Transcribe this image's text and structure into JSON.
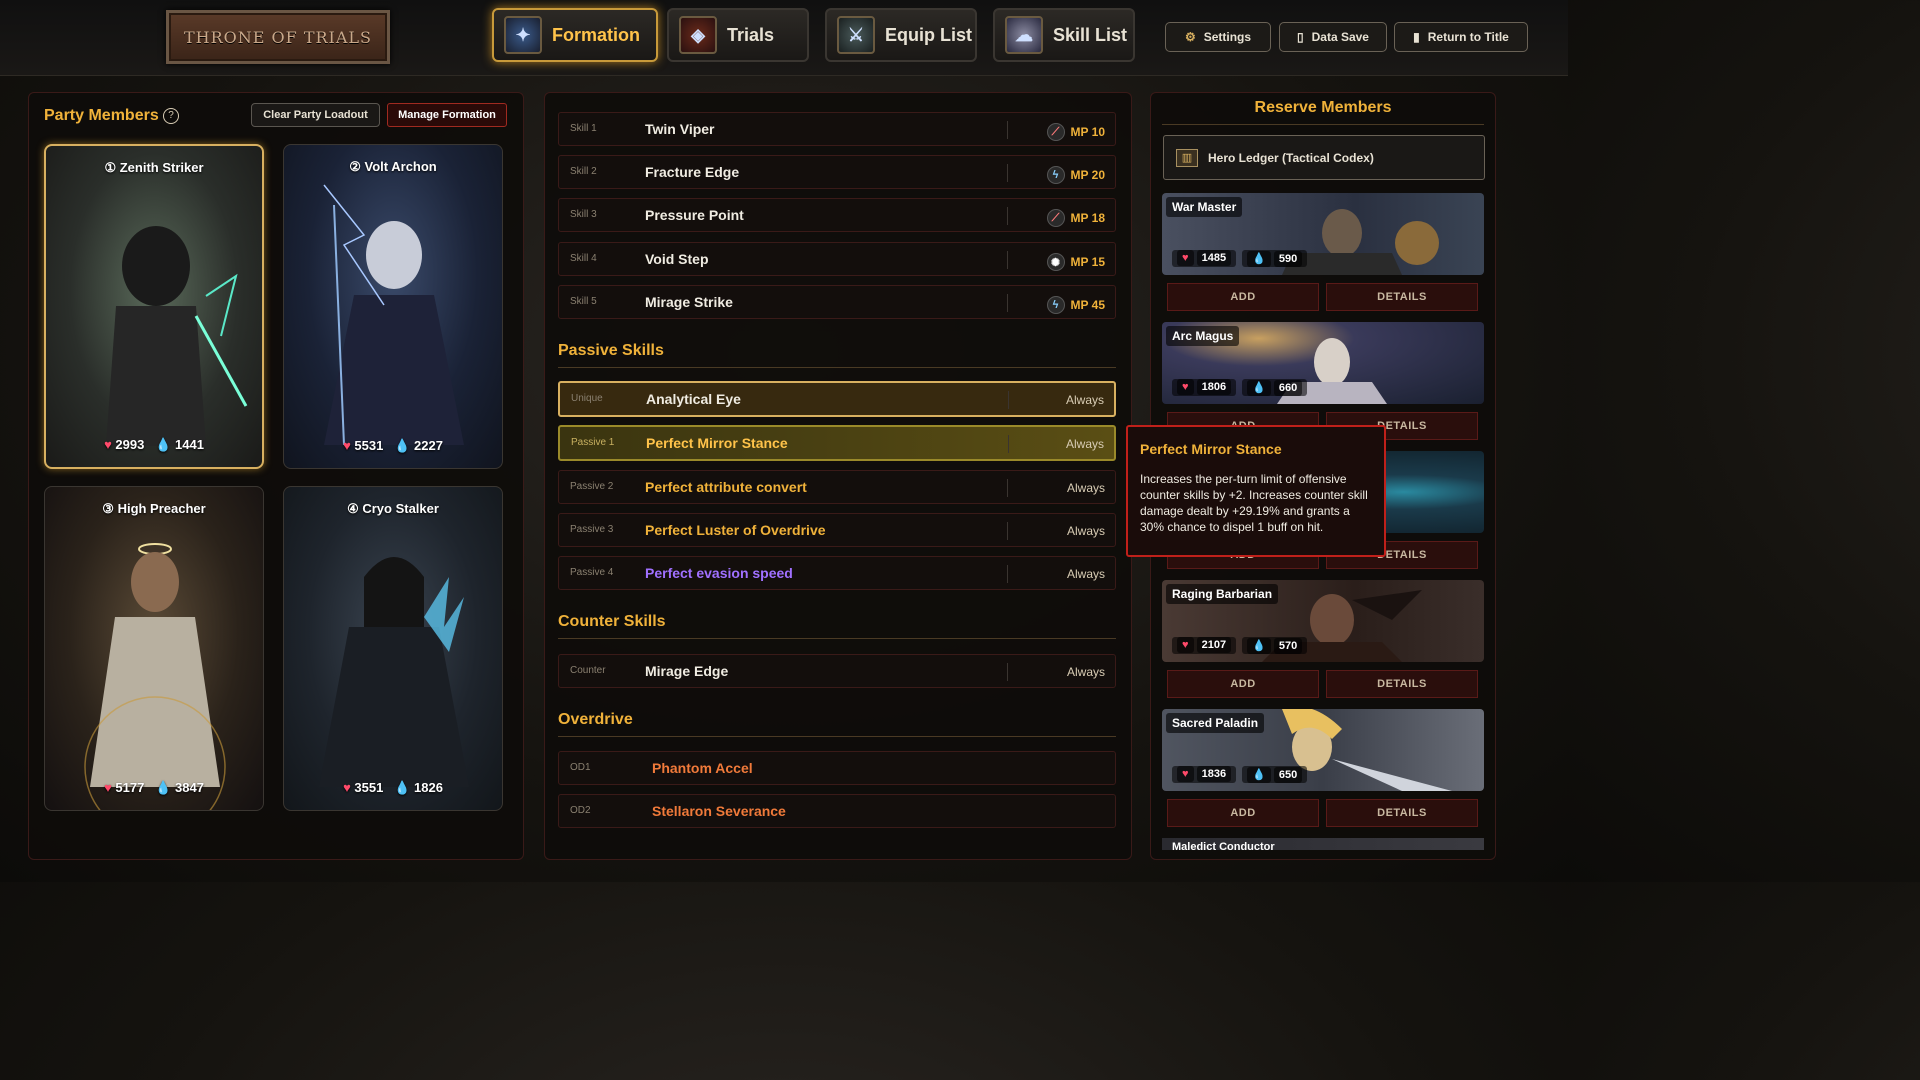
{
  "logo": {
    "text": "THRONE OF TRIALS"
  },
  "tabs": [
    {
      "label": "Formation",
      "icon": "formation-icon",
      "active": true
    },
    {
      "label": "Trials",
      "icon": "trials-icon",
      "active": false
    },
    {
      "label": "Equip List",
      "icon": "equip-icon",
      "active": false
    },
    {
      "label": "Skill List",
      "icon": "skill-icon",
      "active": false
    }
  ],
  "top_buttons": {
    "settings": "Settings",
    "data_save": "Data Save",
    "return": "Return to Title"
  },
  "party": {
    "title": "Party Members",
    "help": "?",
    "clear_button": "Clear Party Loadout",
    "manage_button": "Manage Formation",
    "members": [
      {
        "num": "①",
        "name": "Zenith Striker",
        "hp": "2993",
        "mp": "1441"
      },
      {
        "num": "②",
        "name": "Volt Archon",
        "hp": "5531",
        "mp": "2227"
      },
      {
        "num": "③",
        "name": "High Preacher",
        "hp": "5177",
        "mp": "3847"
      },
      {
        "num": "④",
        "name": "Cryo Stalker",
        "hp": "3551",
        "mp": "1826"
      }
    ]
  },
  "skills": [
    {
      "slot": "Skill 1",
      "name": "Twin Viper",
      "cost": "MP 10",
      "icon": "slash-icon"
    },
    {
      "slot": "Skill 2",
      "name": "Fracture Edge",
      "cost": "MP 20",
      "icon": "lightning-icon"
    },
    {
      "slot": "Skill 3",
      "name": "Pressure Point",
      "cost": "MP 18",
      "icon": "slash-icon"
    },
    {
      "slot": "Skill 4",
      "name": "Void Step",
      "cost": "MP 15",
      "icon": "burst-icon"
    },
    {
      "slot": "Skill 5",
      "name": "Mirage Strike",
      "cost": "MP 45",
      "icon": "lightning-icon"
    }
  ],
  "passive_header": "Passive Skills",
  "passives": [
    {
      "slot": "Unique",
      "name": "Analytical Eye",
      "timing": "Always"
    },
    {
      "slot": "Passive 1",
      "name": "Perfect Mirror Stance",
      "timing": "Always"
    },
    {
      "slot": "Passive 2",
      "name": "Perfect attribute convert",
      "timing": "Always"
    },
    {
      "slot": "Passive 3",
      "name": "Perfect Luster of Overdrive",
      "timing": "Always"
    },
    {
      "slot": "Passive 4",
      "name": "Perfect evasion speed",
      "timing": "Always"
    }
  ],
  "counter_header": "Counter Skills",
  "counter": {
    "slot": "Counter",
    "name": "Mirage Edge",
    "timing": "Always"
  },
  "overdrive_header": "Overdrive",
  "overdrives": [
    {
      "slot": "OD1",
      "name": "Phantom Accel"
    },
    {
      "slot": "OD2",
      "name": "Stellaron Severance"
    }
  ],
  "tooltip": {
    "title": "Perfect Mirror Stance",
    "desc": "Increases the per-turn limit of offensive counter skills by +2. Increases counter skill damage dealt by +29.19% and grants a 30% chance to dispel 1 buff on hit."
  },
  "reserve": {
    "title": "Reserve Members",
    "ledger": "Hero Ledger (Tactical Codex)",
    "add_label": "ADD",
    "details_label": "DETAILS",
    "members": [
      {
        "name": "War Master",
        "hp": "1485",
        "mp": "590"
      },
      {
        "name": "Arc Magus",
        "hp": "1806",
        "mp": "660"
      },
      {
        "name": "",
        "hp": "",
        "mp": ""
      },
      {
        "name": "Raging Barbarian",
        "hp": "2107",
        "mp": "570"
      },
      {
        "name": "Sacred Paladin",
        "hp": "1836",
        "mp": "650"
      }
    ],
    "partial_name": "Maledict Conductor"
  },
  "colors": {
    "accent": "#f0b23a",
    "danger": "#c0201a",
    "hp": "#ff4a6a",
    "mp": "#4aa8ff",
    "purple": "#a070ff"
  }
}
